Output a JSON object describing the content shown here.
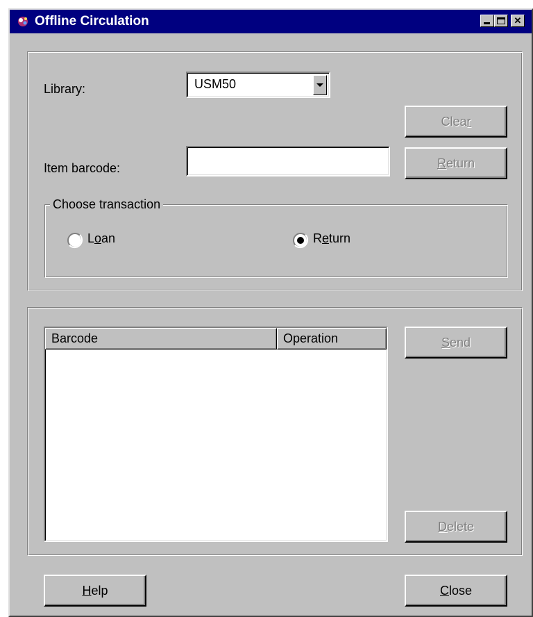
{
  "window": {
    "title": "Offline Circulation",
    "title_color": "#000080",
    "controls": {
      "minimize": "minimize-icon",
      "maximize": "maximize-icon",
      "close": "✕"
    }
  },
  "top_panel": {
    "library_label": "Library:",
    "library_value": "USM50",
    "item_barcode_label": "Item barcode:",
    "item_barcode_value": "",
    "clear_button": {
      "pre": "Clea",
      "ul": "r",
      "post": ""
    },
    "return_button": {
      "pre": "",
      "ul": "R",
      "post": "eturn"
    },
    "transaction_group": {
      "title": "Choose transaction",
      "options": [
        {
          "pre": "L",
          "ul": "o",
          "post": "an",
          "selected": false
        },
        {
          "pre": "R",
          "ul": "e",
          "post": "turn",
          "selected": true
        }
      ]
    }
  },
  "bottom_panel": {
    "list": {
      "columns": [
        "Barcode",
        "Operation"
      ],
      "rows": []
    },
    "send_button": {
      "pre": "",
      "ul": "S",
      "post": "end"
    },
    "delete_button": {
      "pre": "",
      "ul": "D",
      "post": "elete"
    }
  },
  "footer": {
    "help_button": {
      "pre": "",
      "ul": "H",
      "post": "elp"
    },
    "close_button": {
      "pre": "",
      "ul": "C",
      "post": "lose"
    }
  }
}
